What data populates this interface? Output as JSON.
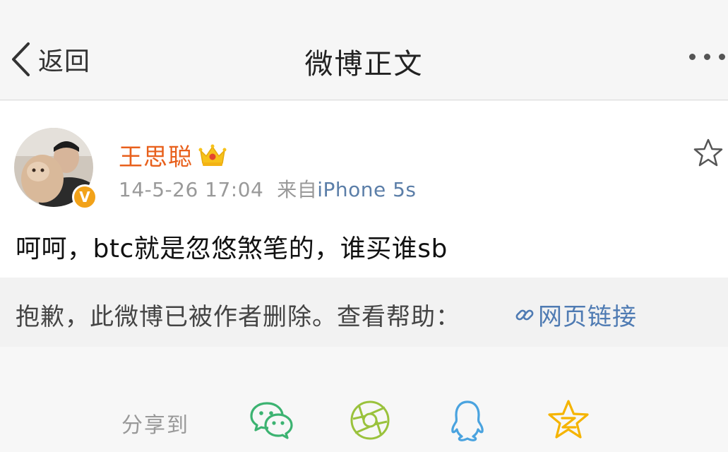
{
  "nav": {
    "back_label": "返回",
    "title": "微博正文"
  },
  "post": {
    "username": "王思聪",
    "timestamp": "14-5-26 17:04",
    "source_prefix": "来自",
    "source": "iPhone 5s",
    "text": "呵呵，btc就是忽悠煞笔的，谁买谁sb",
    "verified_badge": "V"
  },
  "notice": {
    "text": "抱歉，此微博已被作者删除。查看帮助：",
    "link_label": "网页链接"
  },
  "share": {
    "label": "分享到",
    "targets": [
      "wechat-icon",
      "moments-icon",
      "qq-icon",
      "qzone-icon"
    ]
  },
  "colors": {
    "username": "#e8601c",
    "link": "#4f7bb3",
    "wechat": "#3cb371",
    "moments": "#9ac23c",
    "qq": "#4aa3df",
    "qzone": "#f5b400"
  }
}
